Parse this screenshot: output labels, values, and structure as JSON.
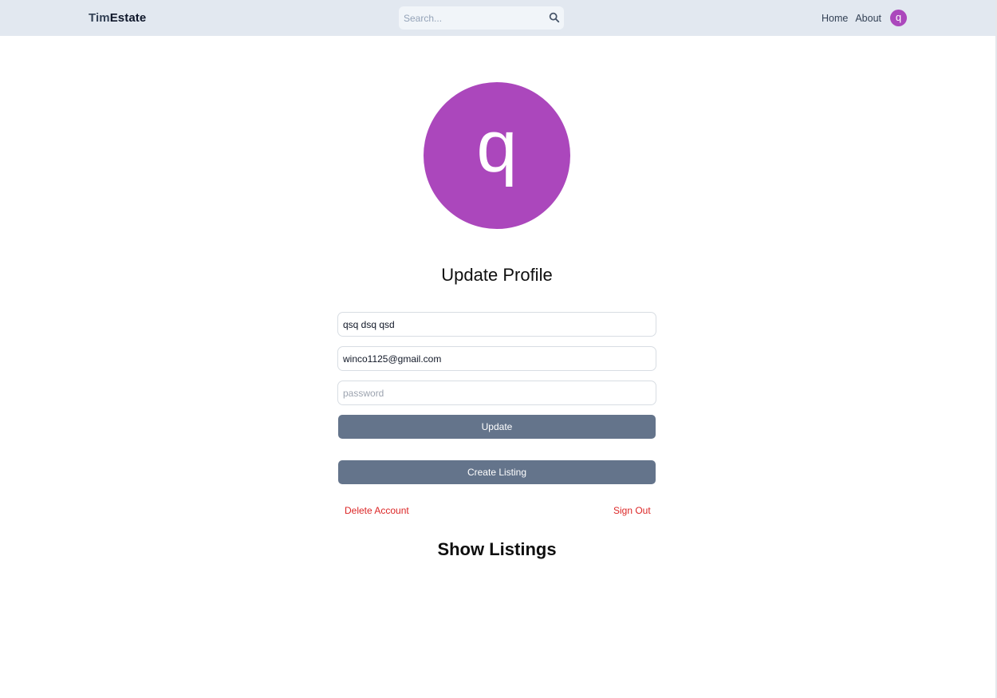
{
  "header": {
    "logo_part1": "Tim",
    "logo_part2": "Estate",
    "search": {
      "placeholder": "Search...",
      "value": "",
      "icon": "search-icon"
    },
    "nav": {
      "home_label": "Home",
      "about_label": "About",
      "avatar_letter": "q"
    }
  },
  "profile": {
    "avatar_letter": "q",
    "avatar_color": "#ab47bc",
    "title": "Update Profile",
    "form": {
      "username_value": "qsq dsq qsd",
      "email_value": "winco1125@gmail.com",
      "password_placeholder": "password",
      "password_value": ""
    },
    "update_label": "Update",
    "create_listing_label": "Create Listing",
    "delete_account_label": "Delete Account",
    "sign_out_label": "Sign Out",
    "show_listings_label": "Show Listings"
  },
  "colors": {
    "header_bg": "#e2e8f0",
    "button_bg": "#64748b",
    "danger": "#dc2626"
  }
}
